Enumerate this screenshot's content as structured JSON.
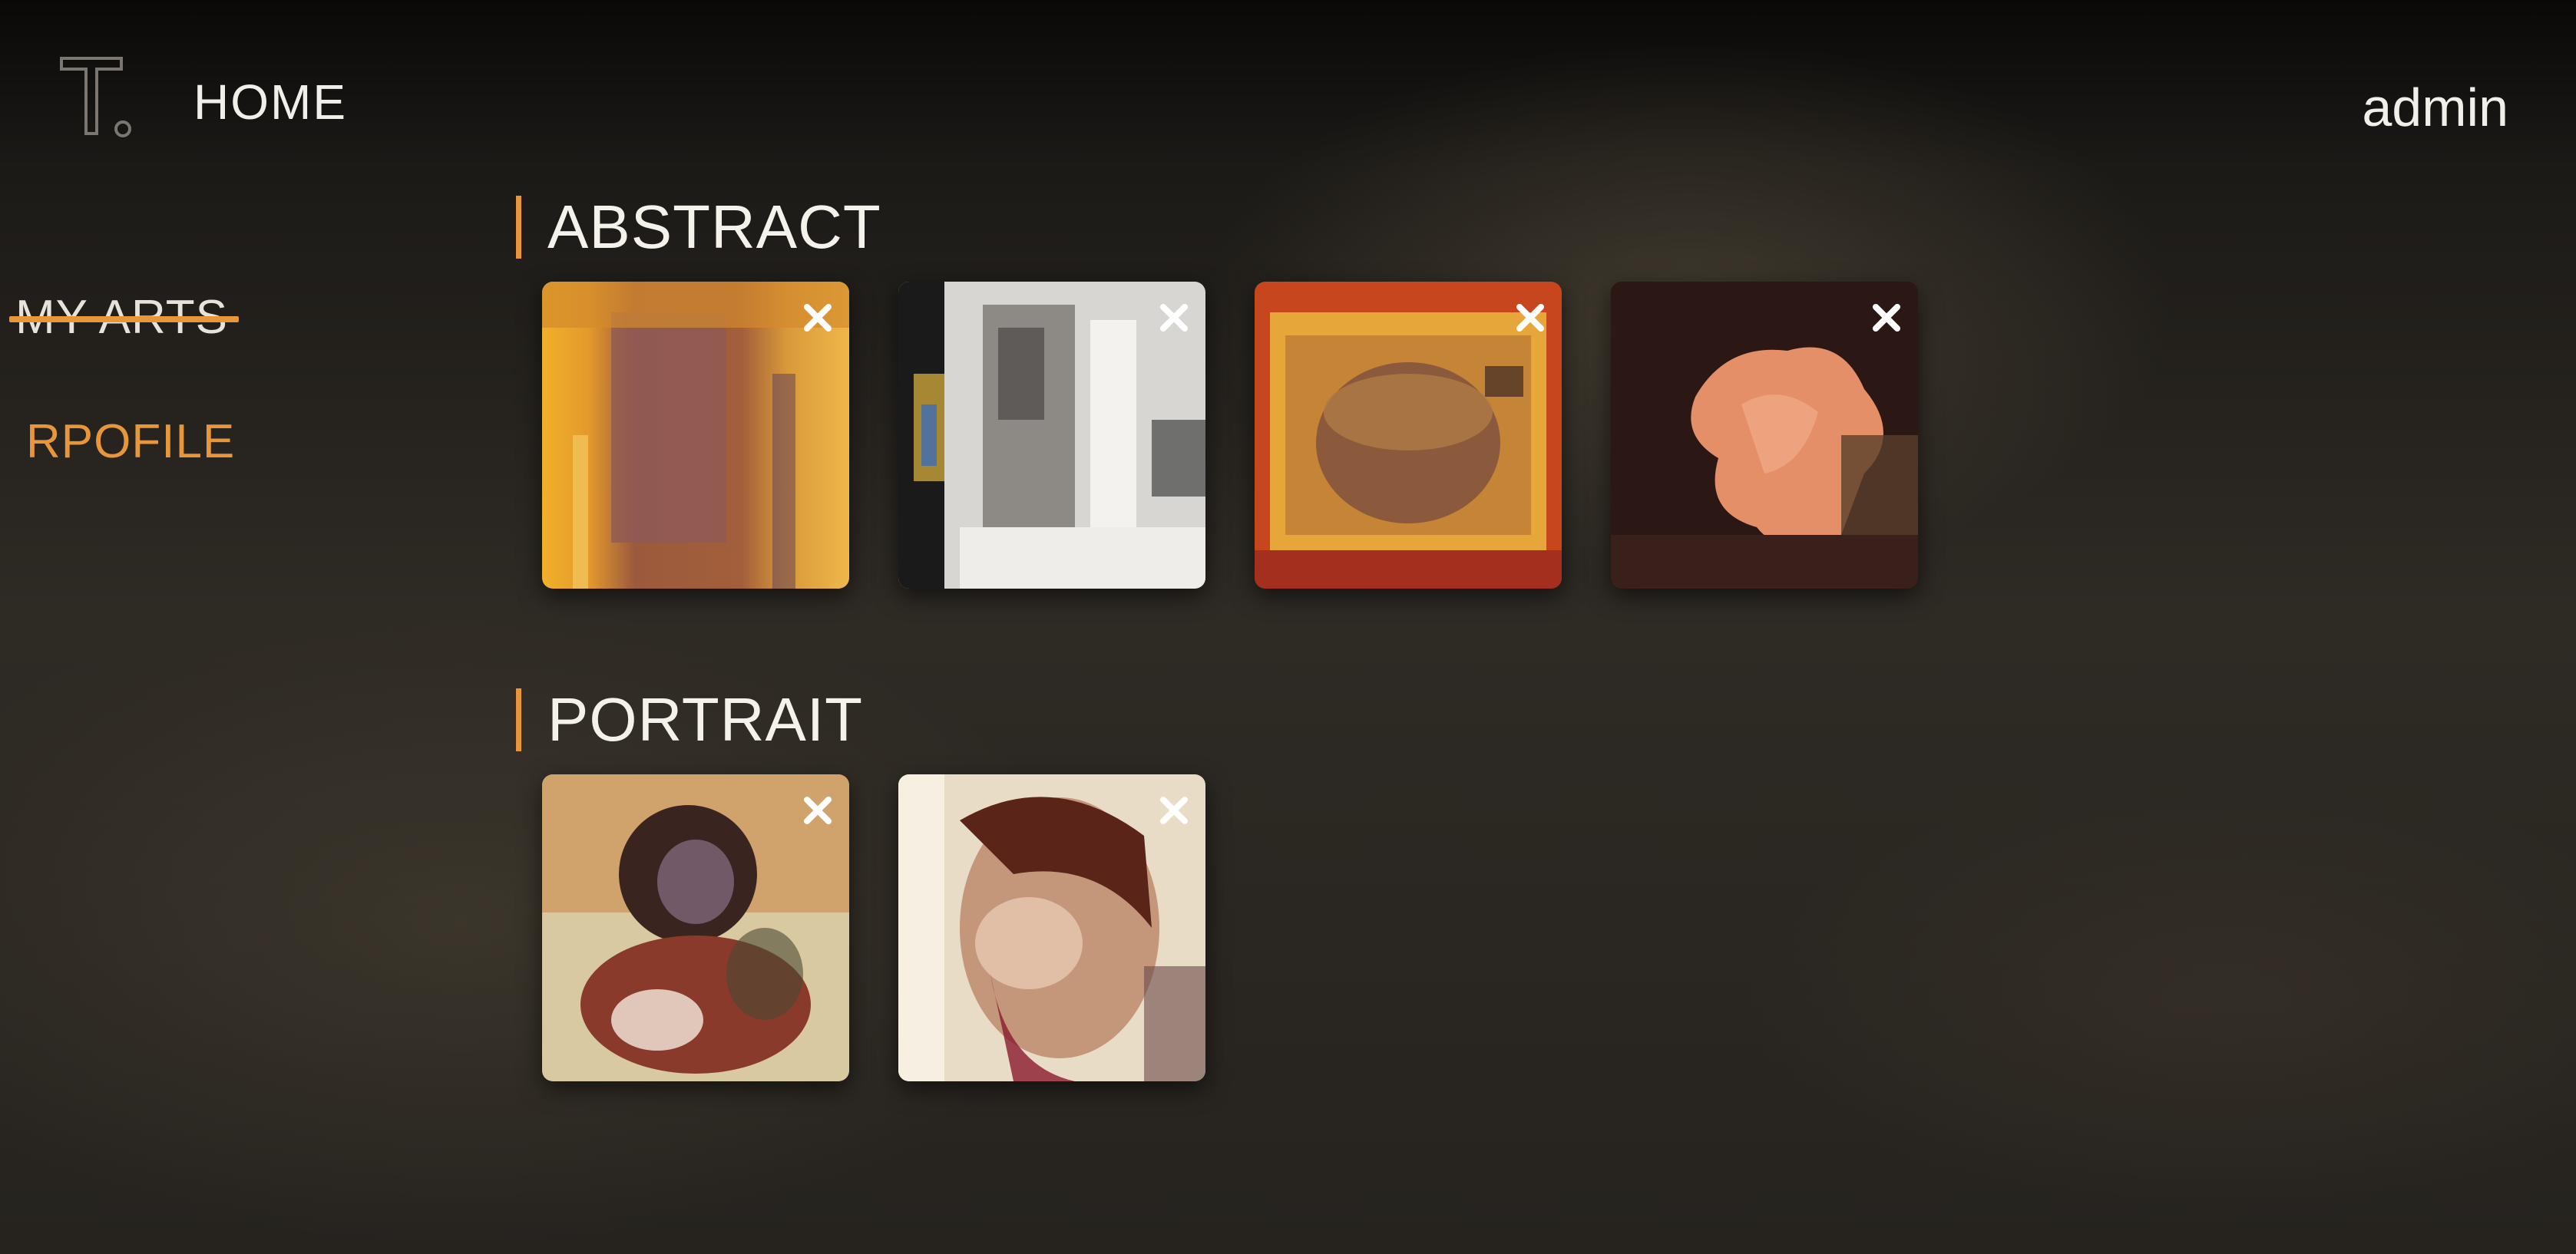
{
  "header": {
    "logo_text": "T.",
    "home_label": "HOME",
    "user_label": "admin"
  },
  "sidebar": {
    "items": [
      {
        "label": "MY ARTS",
        "active": true
      },
      {
        "label": "RPOFILE",
        "active": false
      }
    ]
  },
  "sections": [
    {
      "title": "ABSTRACT",
      "count": 4
    },
    {
      "title": "PORTRAIT",
      "count": 2
    }
  ],
  "colors": {
    "accent": "#e8963c",
    "text": "#f2efea"
  },
  "icons": {
    "remove": "close-icon"
  }
}
